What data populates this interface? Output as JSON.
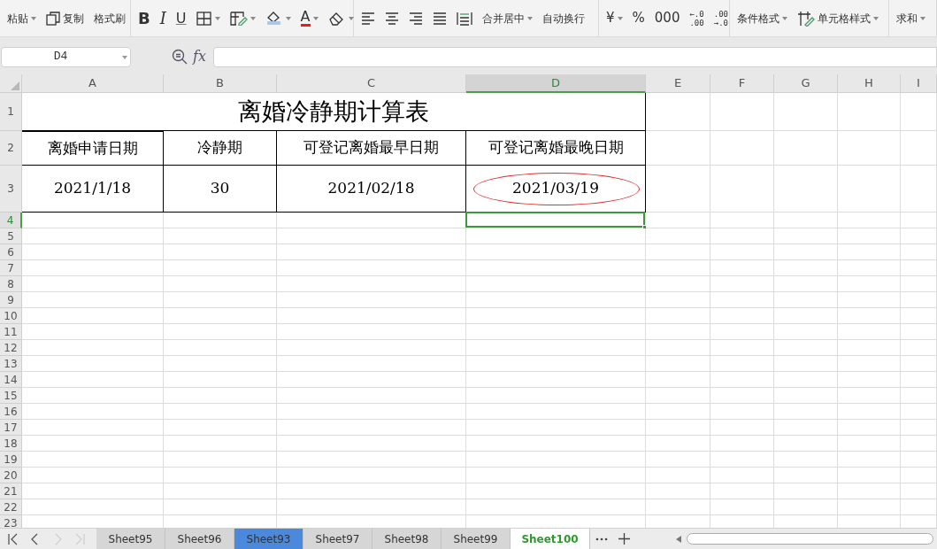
{
  "toolbar": {
    "groups": [
      {
        "items": [
          {
            "kind": "paste",
            "label": "粘贴",
            "dropdown": true
          },
          {
            "kind": "copy",
            "label": "复制",
            "dropdown": false
          },
          {
            "kind": "painter",
            "label": "格式刷",
            "dropdown": false
          }
        ]
      },
      {
        "items": [
          {
            "kind": "bold",
            "label": "B",
            "dropdown": false
          },
          {
            "kind": "italic",
            "label": "I",
            "dropdown": false
          },
          {
            "kind": "underline",
            "label": "U",
            "dropdown": false
          },
          {
            "kind": "borders",
            "dropdown": true
          },
          {
            "kind": "cellfmt",
            "dropdown": true
          },
          {
            "kind": "fill",
            "dropdown": true
          },
          {
            "kind": "fontcolor",
            "label": "A",
            "dropdown": true
          },
          {
            "kind": "eraser",
            "dropdown": true
          }
        ]
      },
      {
        "items": [
          {
            "kind": "alignleft",
            "dropdown": false
          },
          {
            "kind": "aligncenter",
            "dropdown": false
          },
          {
            "kind": "alignright",
            "dropdown": false
          },
          {
            "kind": "justify",
            "dropdown": false
          },
          {
            "kind": "distributed",
            "dropdown": false
          },
          {
            "kind": "text",
            "label": "合并居中",
            "dropdown": true
          },
          {
            "kind": "text",
            "label": "自动换行",
            "dropdown": false
          }
        ]
      },
      {
        "items": [
          {
            "kind": "glyph",
            "label": "¥",
            "dropdown": true
          },
          {
            "kind": "glyph",
            "label": "%",
            "dropdown": false
          },
          {
            "kind": "glyph",
            "label": "000",
            "dropdown": false
          },
          {
            "kind": "twoline",
            "lines": [
              "←.0",
              ".00"
            ],
            "dropdown": false
          },
          {
            "kind": "twoline",
            "lines": [
              ".00",
              "→.0"
            ],
            "dropdown": false
          }
        ]
      },
      {
        "items": [
          {
            "kind": "text",
            "label": "条件格式",
            "dropdown": true
          },
          {
            "kind": "cellstyle",
            "label": "单元格样式",
            "dropdown": true
          }
        ]
      },
      {
        "items": [
          {
            "kind": "text",
            "label": "求和",
            "dropdown": true
          }
        ]
      }
    ]
  },
  "formula_bar": {
    "name_box": "D4",
    "function_label": "fx"
  },
  "columns": [
    {
      "label": "A",
      "selected": false
    },
    {
      "label": "B",
      "selected": false
    },
    {
      "label": "C",
      "selected": false
    },
    {
      "label": "D",
      "selected": true
    },
    {
      "label": "E",
      "selected": false
    },
    {
      "label": "F",
      "selected": false
    },
    {
      "label": "G",
      "selected": false
    },
    {
      "label": "H",
      "selected": false
    },
    {
      "label": "I",
      "selected": false
    }
  ],
  "rows": [
    {
      "label": "1",
      "selected": false
    },
    {
      "label": "2",
      "selected": false
    },
    {
      "label": "3",
      "selected": false
    },
    {
      "label": "4",
      "selected": true
    },
    {
      "label": "5",
      "selected": false
    },
    {
      "label": "6",
      "selected": false
    },
    {
      "label": "7",
      "selected": false
    },
    {
      "label": "8",
      "selected": false
    },
    {
      "label": "9",
      "selected": false
    },
    {
      "label": "10",
      "selected": false
    },
    {
      "label": "11",
      "selected": false
    },
    {
      "label": "12",
      "selected": false
    },
    {
      "label": "13",
      "selected": false
    },
    {
      "label": "14",
      "selected": false
    },
    {
      "label": "15",
      "selected": false
    },
    {
      "label": "16",
      "selected": false
    },
    {
      "label": "17",
      "selected": false
    },
    {
      "label": "18",
      "selected": false
    },
    {
      "label": "19",
      "selected": false
    },
    {
      "label": "20",
      "selected": false
    },
    {
      "label": "21",
      "selected": false
    },
    {
      "label": "22",
      "selected": false
    },
    {
      "label": "23",
      "selected": false
    }
  ],
  "table": {
    "title": "离婚冷静期计算表",
    "header": [
      "离婚申请日期",
      "冷静期",
      "可登记离婚最早日期",
      "可登记离婚最晚日期"
    ],
    "rows": [
      [
        {
          "text": "2021/1/18",
          "circled": false
        },
        {
          "text": "30",
          "circled": false
        },
        {
          "text": "2021/02/18",
          "circled": false
        },
        {
          "text": "2021/03/19",
          "circled": true
        }
      ]
    ]
  },
  "sheet_tabs": [
    {
      "label": "Sheet95",
      "selected": false,
      "color": "#d6d6d6"
    },
    {
      "label": "Sheet96",
      "selected": false,
      "color": "#d6d6d6"
    },
    {
      "label": "Sheet93",
      "selected": false,
      "color": "#4a89dc"
    },
    {
      "label": "Sheet97",
      "selected": false,
      "color": "#d6d6d6"
    },
    {
      "label": "Sheet98",
      "selected": false,
      "color": "#d6d6d6"
    },
    {
      "label": "Sheet99",
      "selected": false,
      "color": "#d6d6d6"
    },
    {
      "label": "Sheet100",
      "selected": true,
      "color": "#ffffff"
    }
  ]
}
